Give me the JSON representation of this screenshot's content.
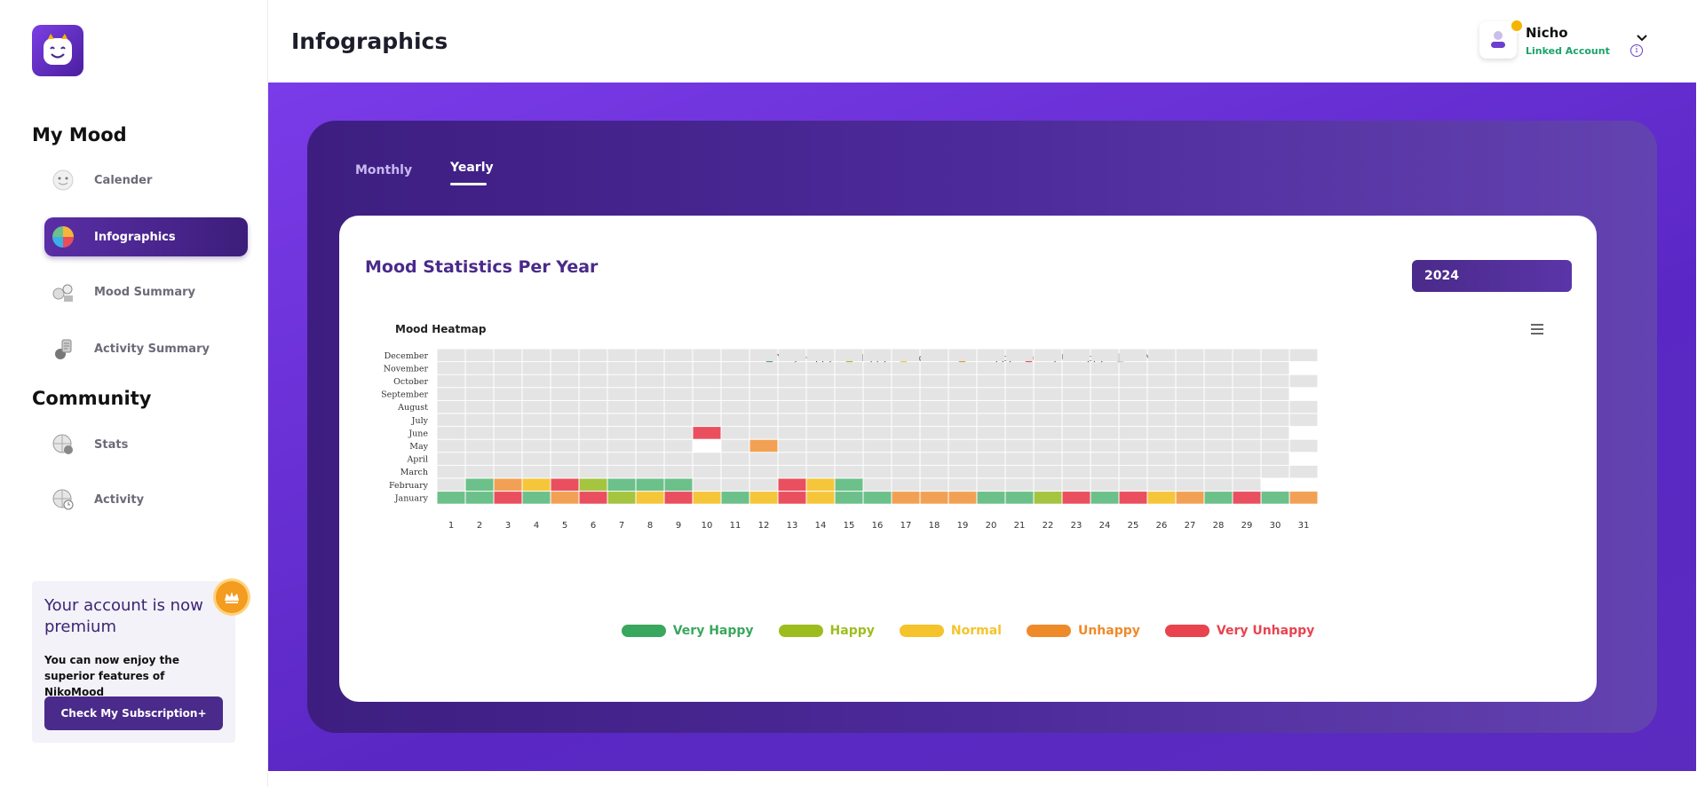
{
  "sidebar": {
    "my_mood_title": "My Mood",
    "community_title": "Community",
    "items": [
      {
        "label": "Calender",
        "icon": "calendar-emoji-icon"
      },
      {
        "label": "Infographics",
        "icon": "pie-chart-icon"
      },
      {
        "label": "Mood Summary",
        "icon": "mood-summary-icon"
      },
      {
        "label": "Activity Summary",
        "icon": "activity-summary-icon"
      },
      {
        "label": "Stats",
        "icon": "globe-stats-icon"
      },
      {
        "label": "Activity",
        "icon": "globe-activity-icon"
      }
    ],
    "premium": {
      "title": "Your account is now premium",
      "text": "You can now enjoy the superior features of NikoMood",
      "button": "Check My Subscription+"
    }
  },
  "header": {
    "title": "Infographics",
    "user_name": "Nicho",
    "user_status": "Linked Account",
    "info_glyph": "i"
  },
  "tabs": {
    "monthly": "Monthly",
    "yearly": "Yearly",
    "active": "Yearly"
  },
  "card": {
    "title": "Mood Statistics Per Year",
    "year": "2024",
    "heatmap_title": "Mood Heatmap"
  },
  "colors": {
    "very_happy": "#6cc08a",
    "happy": "#a5c440",
    "normal": "#f5c63a",
    "unhappy": "#f2a154",
    "very_unhappy": "#ea4f5f",
    "no_mood": "#e4e4e4",
    "legend_very_happy": "#3aa75e",
    "legend_happy": "#9dbd1e",
    "legend_normal": "#f5c32b",
    "legend_unhappy": "#ef8a2a",
    "legend_very_unhappy": "#e8434f"
  },
  "legend": [
    {
      "key": "very_happy",
      "label": "Very Happy"
    },
    {
      "key": "happy",
      "label": "Happy"
    },
    {
      "key": "normal",
      "label": "Normal"
    },
    {
      "key": "unhappy",
      "label": "Unhappy"
    },
    {
      "key": "very_unhappy",
      "label": "Very Unhappy"
    },
    {
      "key": "no_mood",
      "label": "No Mood"
    }
  ],
  "chart_data": {
    "type": "heatmap",
    "title": "Mood Heatmap",
    "x": [
      "1",
      "2",
      "3",
      "4",
      "5",
      "6",
      "7",
      "8",
      "9",
      "10",
      "11",
      "12",
      "13",
      "14",
      "15",
      "16",
      "17",
      "18",
      "19",
      "20",
      "21",
      "22",
      "23",
      "24",
      "25",
      "26",
      "27",
      "28",
      "29",
      "30",
      "31"
    ],
    "y": [
      "January",
      "February",
      "March",
      "April",
      "May",
      "June",
      "July",
      "August",
      "September",
      "October",
      "November",
      "December"
    ],
    "categories": [
      "very_happy",
      "happy",
      "normal",
      "unhappy",
      "very_unhappy",
      "no_mood"
    ],
    "values": {
      "January": [
        "very_happy",
        "very_happy",
        "very_unhappy",
        "very_happy",
        "unhappy",
        "very_unhappy",
        "happy",
        "normal",
        "very_unhappy",
        "normal",
        "very_happy",
        "normal",
        "very_unhappy",
        "normal",
        "very_happy",
        "very_happy",
        "unhappy",
        "unhappy",
        "unhappy",
        "very_happy",
        "very_happy",
        "happy",
        "very_unhappy",
        "very_happy",
        "very_unhappy",
        "normal",
        "unhappy",
        "very_happy",
        "very_unhappy",
        "very_happy",
        "unhappy"
      ],
      "February": [
        "no_mood",
        "very_happy",
        "unhappy",
        "normal",
        "very_unhappy",
        "happy",
        "very_happy",
        "very_happy",
        "very_happy",
        "no_mood",
        "no_mood",
        "no_mood",
        "very_unhappy",
        "normal",
        "very_happy",
        "no_mood",
        "no_mood",
        "no_mood",
        "no_mood",
        "no_mood",
        "no_mood",
        "no_mood",
        "no_mood",
        "no_mood",
        "no_mood",
        "no_mood",
        "no_mood",
        "no_mood",
        "no_mood",
        null,
        null
      ],
      "May": {
        "10": null,
        "12": "unhappy"
      },
      "June": {
        "10": "very_unhappy"
      }
    },
    "months_with_31_days": [
      "January",
      "March",
      "May",
      "July",
      "August",
      "October",
      "December"
    ],
    "legend_bottom": [
      {
        "key": "very_happy",
        "label": "Very Happy"
      },
      {
        "key": "happy",
        "label": "Happy"
      },
      {
        "key": "normal",
        "label": "Normal"
      },
      {
        "key": "unhappy",
        "label": "Unhappy"
      },
      {
        "key": "very_unhappy",
        "label": "Very Unhappy"
      }
    ]
  }
}
